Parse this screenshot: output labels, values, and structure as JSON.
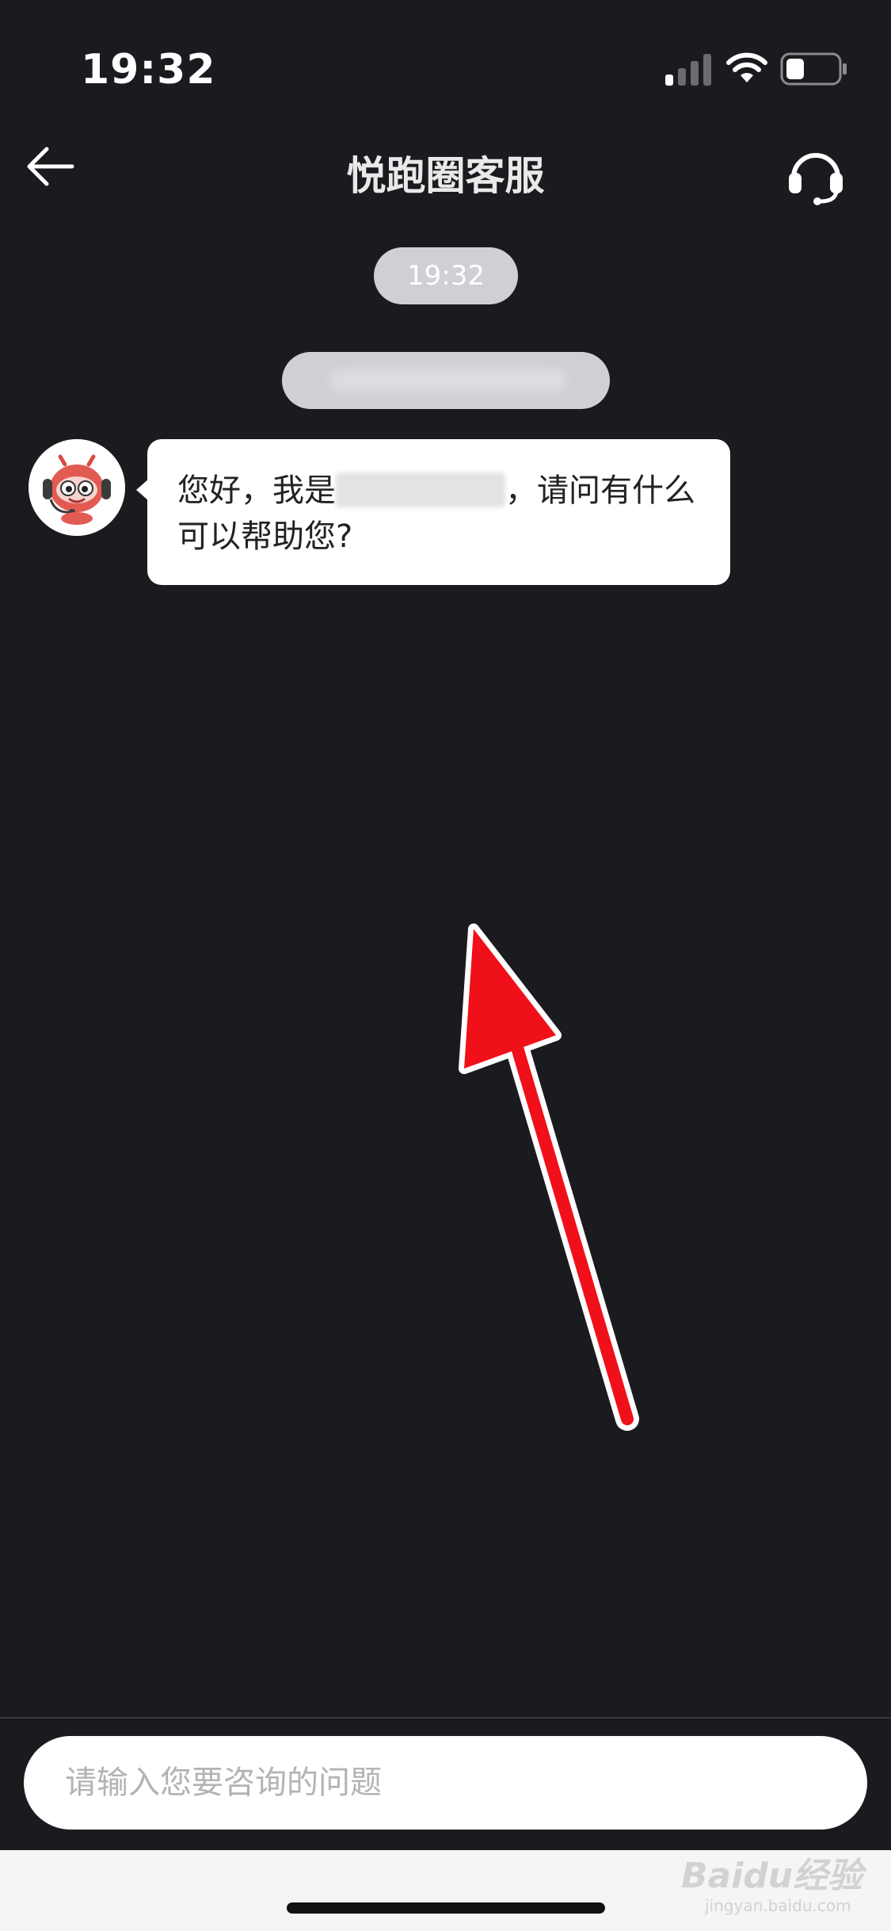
{
  "status_bar": {
    "time": "19:32"
  },
  "nav": {
    "title": "悦跑圈客服",
    "back_icon": "arrow-left-icon",
    "headset_icon": "headset-icon"
  },
  "chat": {
    "timestamp": "19:32",
    "messages": [
      {
        "sender": "agent",
        "text_before": "您好，我是",
        "text_after": "，请问有什么可以帮助您?"
      }
    ]
  },
  "input": {
    "placeholder": "请输入您要咨询的问题",
    "value": ""
  },
  "watermark": {
    "text": "Baidu经验",
    "sub": "jingyan.baidu.com"
  },
  "colors": {
    "background": "#1a1b1f",
    "pill": "#cfd0d4",
    "arrow": "#f0101a"
  }
}
